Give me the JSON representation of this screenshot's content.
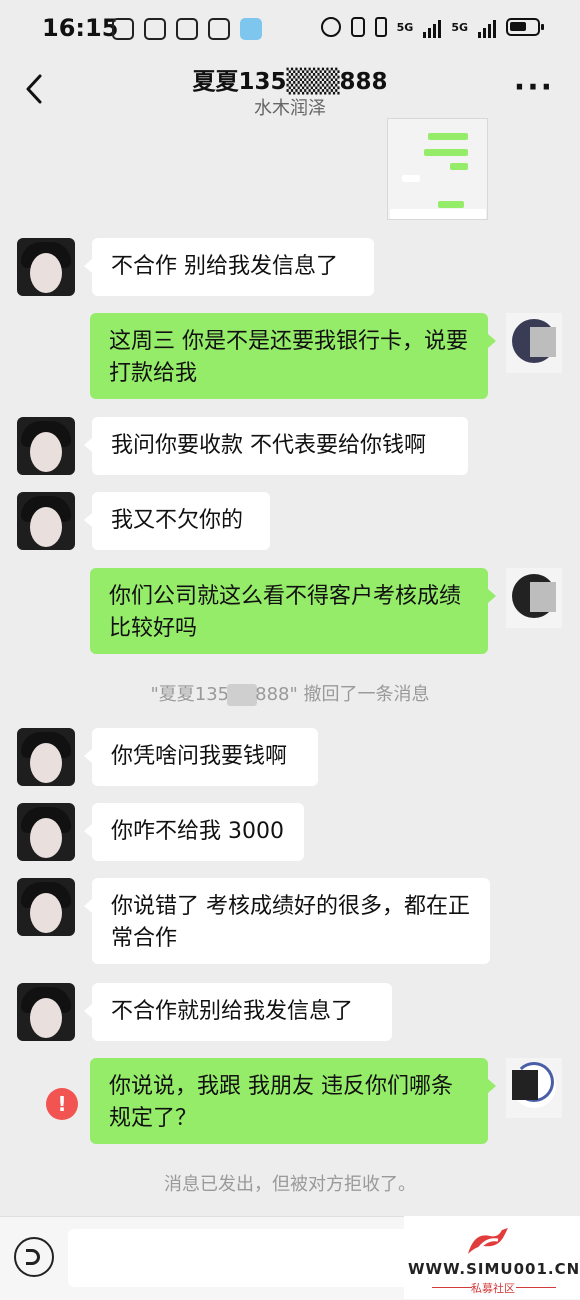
{
  "status_bar": {
    "time": "16:15",
    "network_1": "5G",
    "network_2": "5G"
  },
  "header": {
    "contact_name": "夏夏135▒▒▒888",
    "contact_subtitle": "水木润泽",
    "more_label": "···"
  },
  "messages": [
    {
      "side": "in",
      "text": "不合作 别给我发信息了"
    },
    {
      "side": "out",
      "text": "这周三 你是不是还要我银行卡，说要打款给我"
    },
    {
      "side": "in",
      "text": "我问你要收款 不代表要给你钱啊"
    },
    {
      "side": "in",
      "text": "我又不欠你的"
    },
    {
      "side": "out",
      "text": "你们公司就这么看不得客户考核成绩比较好吗"
    },
    {
      "side": "in",
      "text": "你凭啥问我要钱啊"
    },
    {
      "side": "in",
      "text": "你咋不给我 3000"
    },
    {
      "side": "in",
      "text": "你说错了 考核成绩好的很多，都在正常合作"
    },
    {
      "side": "in",
      "text": "不合作就别给我发信息了"
    },
    {
      "side": "out",
      "text": "你说说，我跟 我朋友 违反你们哪条规定了？"
    }
  ],
  "system": {
    "recall_prefix": "\"夏夏135",
    "recall_suffix": "888\" 撤回了一条消息",
    "rejected": "消息已发出，但被对方拒收了。",
    "error_mark": "!"
  },
  "input": {
    "placeholder": ""
  },
  "watermark": {
    "url": "WWW.SIMU001.CN",
    "tag": "私募社区"
  },
  "colors": {
    "background": "#ededed",
    "incoming_bubble": "#ffffff",
    "outgoing_bubble": "#95ec69",
    "error": "#f25452"
  }
}
